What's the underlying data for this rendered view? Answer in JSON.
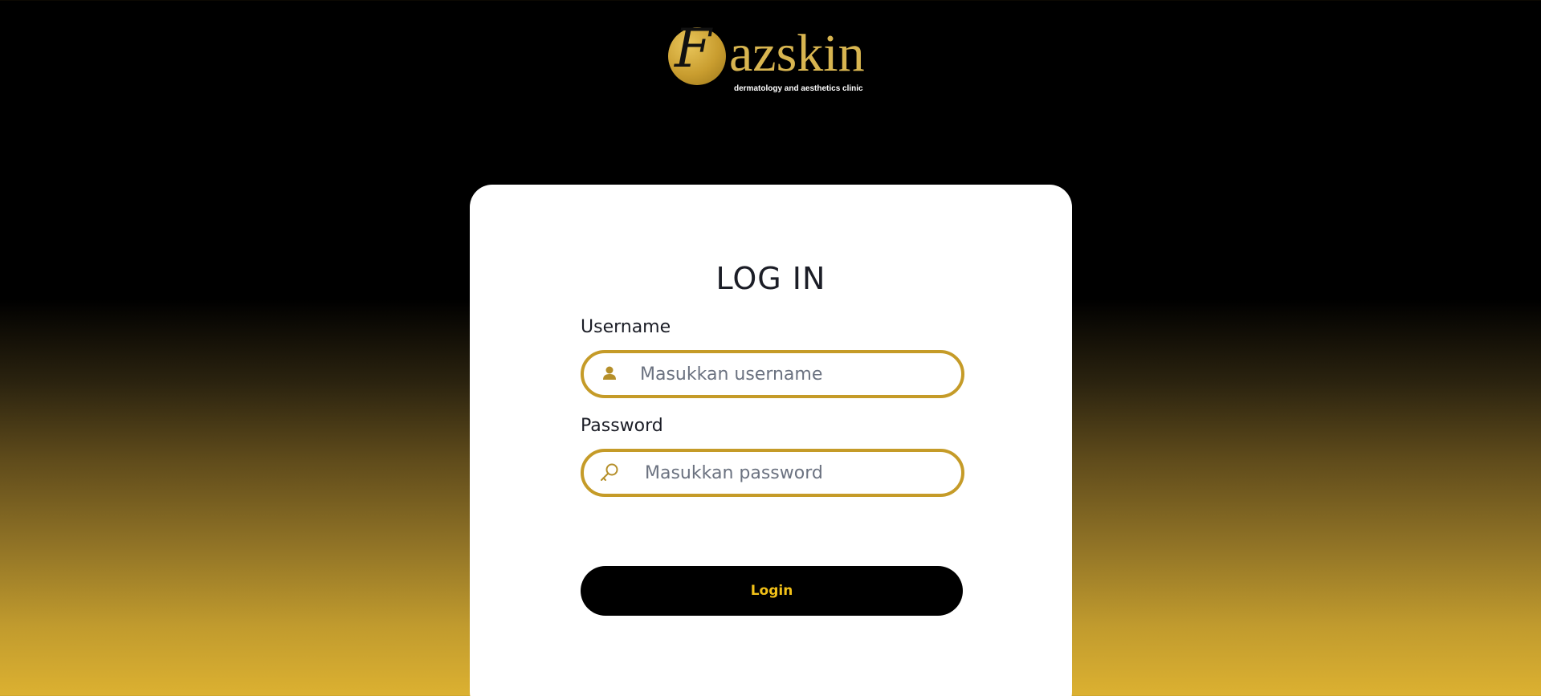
{
  "logo": {
    "monogram": "F",
    "wordmark": "azskin",
    "tagline": "dermatology and aesthetics clinic"
  },
  "form": {
    "title": "LOG IN",
    "username": {
      "label": "Username",
      "placeholder": "Masukkan username",
      "value": "",
      "icon": "user-icon"
    },
    "password": {
      "label": "Password",
      "placeholder": "Masukkan password",
      "value": "",
      "icon": "key-icon"
    },
    "login_label": "Login"
  },
  "colors": {
    "accent_gold": "#c59b28",
    "button_bg": "#000000",
    "button_text": "#f2c118",
    "card_bg": "#ffffff"
  }
}
